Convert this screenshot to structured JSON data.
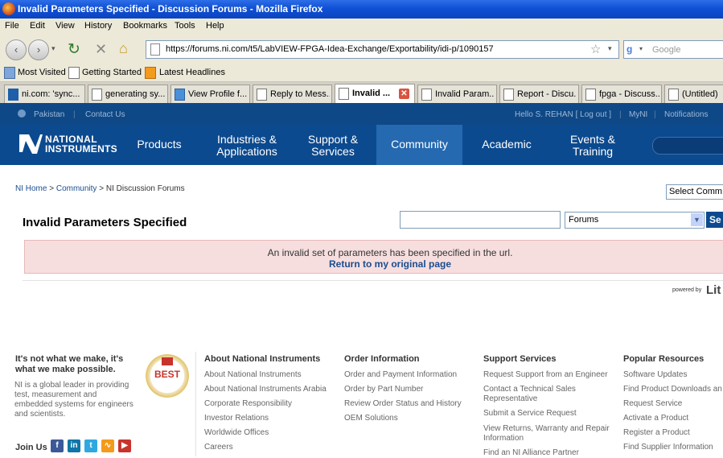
{
  "window": {
    "title": "Invalid Parameters Specified - Discussion Forums - Mozilla Firefox"
  },
  "menu": [
    "File",
    "Edit",
    "View",
    "History",
    "Bookmarks",
    "Tools",
    "Help"
  ],
  "nav": {
    "url": "https://forums.ni.com/t5/LabVIEW-FPGA-Idea-Exchange/Exportability/idi-p/1090157",
    "search_placeholder": "Google"
  },
  "bookmarks": [
    "Most Visited",
    "Getting Started",
    "Latest Headlines"
  ],
  "tabs": [
    {
      "label": "ni.com: 'sync..."
    },
    {
      "label": "generating sy..."
    },
    {
      "label": "View Profile f..."
    },
    {
      "label": "Reply to Mess..."
    },
    {
      "label": "Invalid ...",
      "active": true
    },
    {
      "label": "Invalid Param..."
    },
    {
      "label": "Report - Discu..."
    },
    {
      "label": "fpga - Discuss..."
    },
    {
      "label": "(Untitled)"
    }
  ],
  "ni_top": {
    "country": "Pakistan",
    "contact": "Contact Us",
    "hello": "Hello S. REHAN [ Log out ]",
    "myni": "MyNI",
    "notifications": "Notifications"
  },
  "logo": {
    "line1": "NATIONAL",
    "line2": "INSTRUMENTS"
  },
  "ni_nav": [
    {
      "l1": "Products",
      "l2": ""
    },
    {
      "l1": "Industries &",
      "l2": "Applications"
    },
    {
      "l1": "Support &",
      "l2": "Services"
    },
    {
      "l1": "Community",
      "l2": "",
      "active": true
    },
    {
      "l1": "Academic",
      "l2": ""
    },
    {
      "l1": "Events &",
      "l2": "Training"
    }
  ],
  "breadcrumb": {
    "home": "NI Home",
    "sep1": " > ",
    "community": "Community",
    "sep2": " > ",
    "current": "NI Discussion Forums"
  },
  "select_community": "Select Comm",
  "page_title": "Invalid Parameters Specified",
  "search": {
    "value": "",
    "scope": "Forums",
    "button": "Se"
  },
  "alert": {
    "message": "An invalid set of parameters has been specified in the url.",
    "link": "Return to my original page"
  },
  "powered_by": "powered by",
  "powered_brand": "Lit",
  "footer": {
    "tagline": "It's not what we make, it's what we make possible.",
    "blurb": "NI is a global leader in providing test, measurement and embedded systems for engineers and scientists.",
    "join_us": "Join Us",
    "badge": "BEST",
    "cols": [
      {
        "title": "About National Instruments",
        "links": [
          "About National Instruments",
          "About National Instruments Arabia",
          "Corporate Responsibility",
          "Investor Relations",
          "Worldwide Offices",
          "Careers"
        ]
      },
      {
        "title": "Order Information",
        "links": [
          "Order and Payment Information",
          "Order by Part Number",
          "Review Order Status and History",
          "OEM Solutions"
        ]
      },
      {
        "title": "Support Services",
        "links": [
          "Request Support from an Engineer",
          "Contact a Technical Sales Representative",
          "Submit a Service Request",
          "View Returns, Warranty and Repair Information",
          "Find an NI Alliance Partner"
        ]
      },
      {
        "title": "Popular Resources",
        "links": [
          "Software Updates",
          "Find Product Downloads an",
          "Request Service",
          "Activate a Product",
          "Register a Product",
          "Find Supplier Information"
        ]
      }
    ]
  }
}
